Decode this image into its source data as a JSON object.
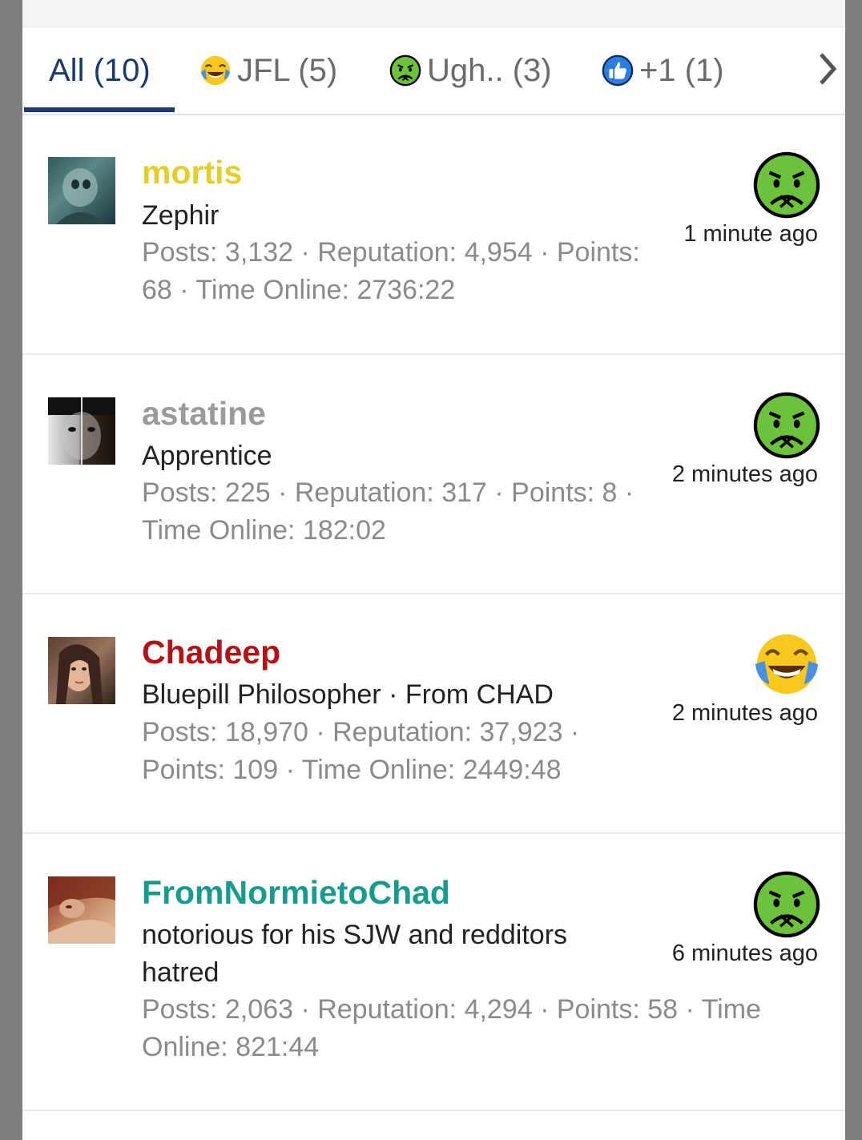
{
  "tabs": [
    {
      "label": "All (10)",
      "icon": "none",
      "active": true
    },
    {
      "label": "JFL (5)",
      "icon": "crying-laughing-emoji-icon",
      "active": false
    },
    {
      "label": "Ugh.. (3)",
      "icon": "sick-face-emoji-icon",
      "active": false
    },
    {
      "label": "+1 (1)",
      "icon": "thumbs-up-icon",
      "active": false
    }
  ],
  "tabs_next_icon": "chevron-right-icon",
  "accent_color": "#1c3a6e",
  "reactions": [
    {
      "username": "mortis",
      "username_color": "#e3cf2b",
      "title": "Zephir",
      "stats": "Posts: 3,132 · Reputation: 4,954 · Points: 68 · Time Online: 2736:22",
      "reaction": "sick-face-emoji-icon",
      "time_ago": "1 minute ago"
    },
    {
      "username": "astatine",
      "username_color": "#9a9a9a",
      "title": "Apprentice",
      "stats": "Posts: 225 · Reputation: 317 · Points: 8 · Time Online: 182:02",
      "reaction": "sick-face-emoji-icon",
      "time_ago": "2 minutes ago"
    },
    {
      "username": "Chadeep",
      "username_color": "#b31217",
      "title": "Bluepill Philosopher · From CHAD",
      "stats": "Posts: 18,970 · Reputation: 37,923 · Points: 109 · Time Online: 2449:48",
      "reaction": "crying-laughing-emoji-icon",
      "time_ago": "2 minutes ago"
    },
    {
      "username": "FromNormietoChad",
      "username_color": "#189b8f",
      "title": "notorious for his SJW and redditors hatred",
      "stats": "Posts: 2,063 · Reputation: 4,294 · Points: 58 · Time Online: 821:44",
      "reaction": "sick-face-emoji-icon",
      "time_ago": "6 minutes ago"
    }
  ]
}
